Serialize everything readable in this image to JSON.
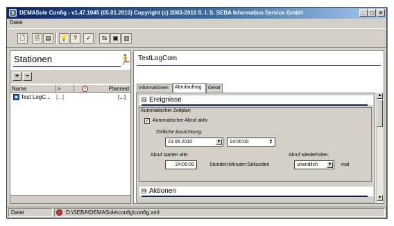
{
  "window": {
    "title": "DEMASole Config - v1.47.1045 (05.01.2010) Copyright (c) 2003-2010 S. I. S. SEBA Information Service GmbH",
    "minimize_label": "_",
    "maximize_label": "□",
    "close_label": "×"
  },
  "menu": {
    "items": [
      "Datei"
    ]
  },
  "toolbar": {
    "buttons": [
      {
        "icon": "new-document-icon",
        "glyph": "🗋"
      },
      {
        "icon": "open-document-icon",
        "glyph": "🗎"
      },
      {
        "icon": "print-icon",
        "glyph": "▤"
      },
      {
        "icon": "lightbulb-icon",
        "glyph": "💡"
      },
      {
        "icon": "help-icon",
        "glyph": "?"
      },
      {
        "icon": "check-icon",
        "glyph": "✓"
      },
      {
        "icon": "connect-icon",
        "glyph": "⇆"
      },
      {
        "icon": "monitor-icon",
        "glyph": "▣"
      },
      {
        "icon": "chart-icon",
        "glyph": "▥"
      }
    ]
  },
  "left_pane": {
    "title": "Stationen",
    "add_label": "+",
    "remove_label": "−",
    "columns": {
      "name": "Name",
      "arrow": ">",
      "planned": "Planned"
    },
    "stations": [
      {
        "name": "Test LogC...",
        "col2": "[...]",
        "planned": "[...]"
      }
    ]
  },
  "right_pane": {
    "station_name": "TestLogCom",
    "tabs": [
      "Informationen",
      "Abrufauftrag",
      "Gerät"
    ],
    "active_tab": 1,
    "sections": {
      "ereignisse": {
        "toggle": "⊟",
        "title": "Ereignisse",
        "group_title": "Automatischer Zeitplan",
        "auto_abruf_label": "Automatischer Abruf aktiv",
        "auto_abruf_checked": "✓",
        "zeitliche_label": "Zeitliche Ausrichtung:",
        "date_value": "23.06.2010",
        "time_value": "14:00:00",
        "abruf_starten_label": "Abruf starten alle:",
        "interval_value": "24:00:00",
        "interval_unit": "Stunden:Minuten:Sekunden",
        "wiederholen_label": "Abruf wiederholen:",
        "repeat_value": "unendlich",
        "repeat_unit": "mal"
      },
      "aktionen": {
        "toggle": "⊟",
        "title": "Aktionen"
      }
    }
  },
  "statusbar": {
    "left": "Datei",
    "path": "D:\\SEBA\\DEMASole\\config\\config.xml"
  }
}
